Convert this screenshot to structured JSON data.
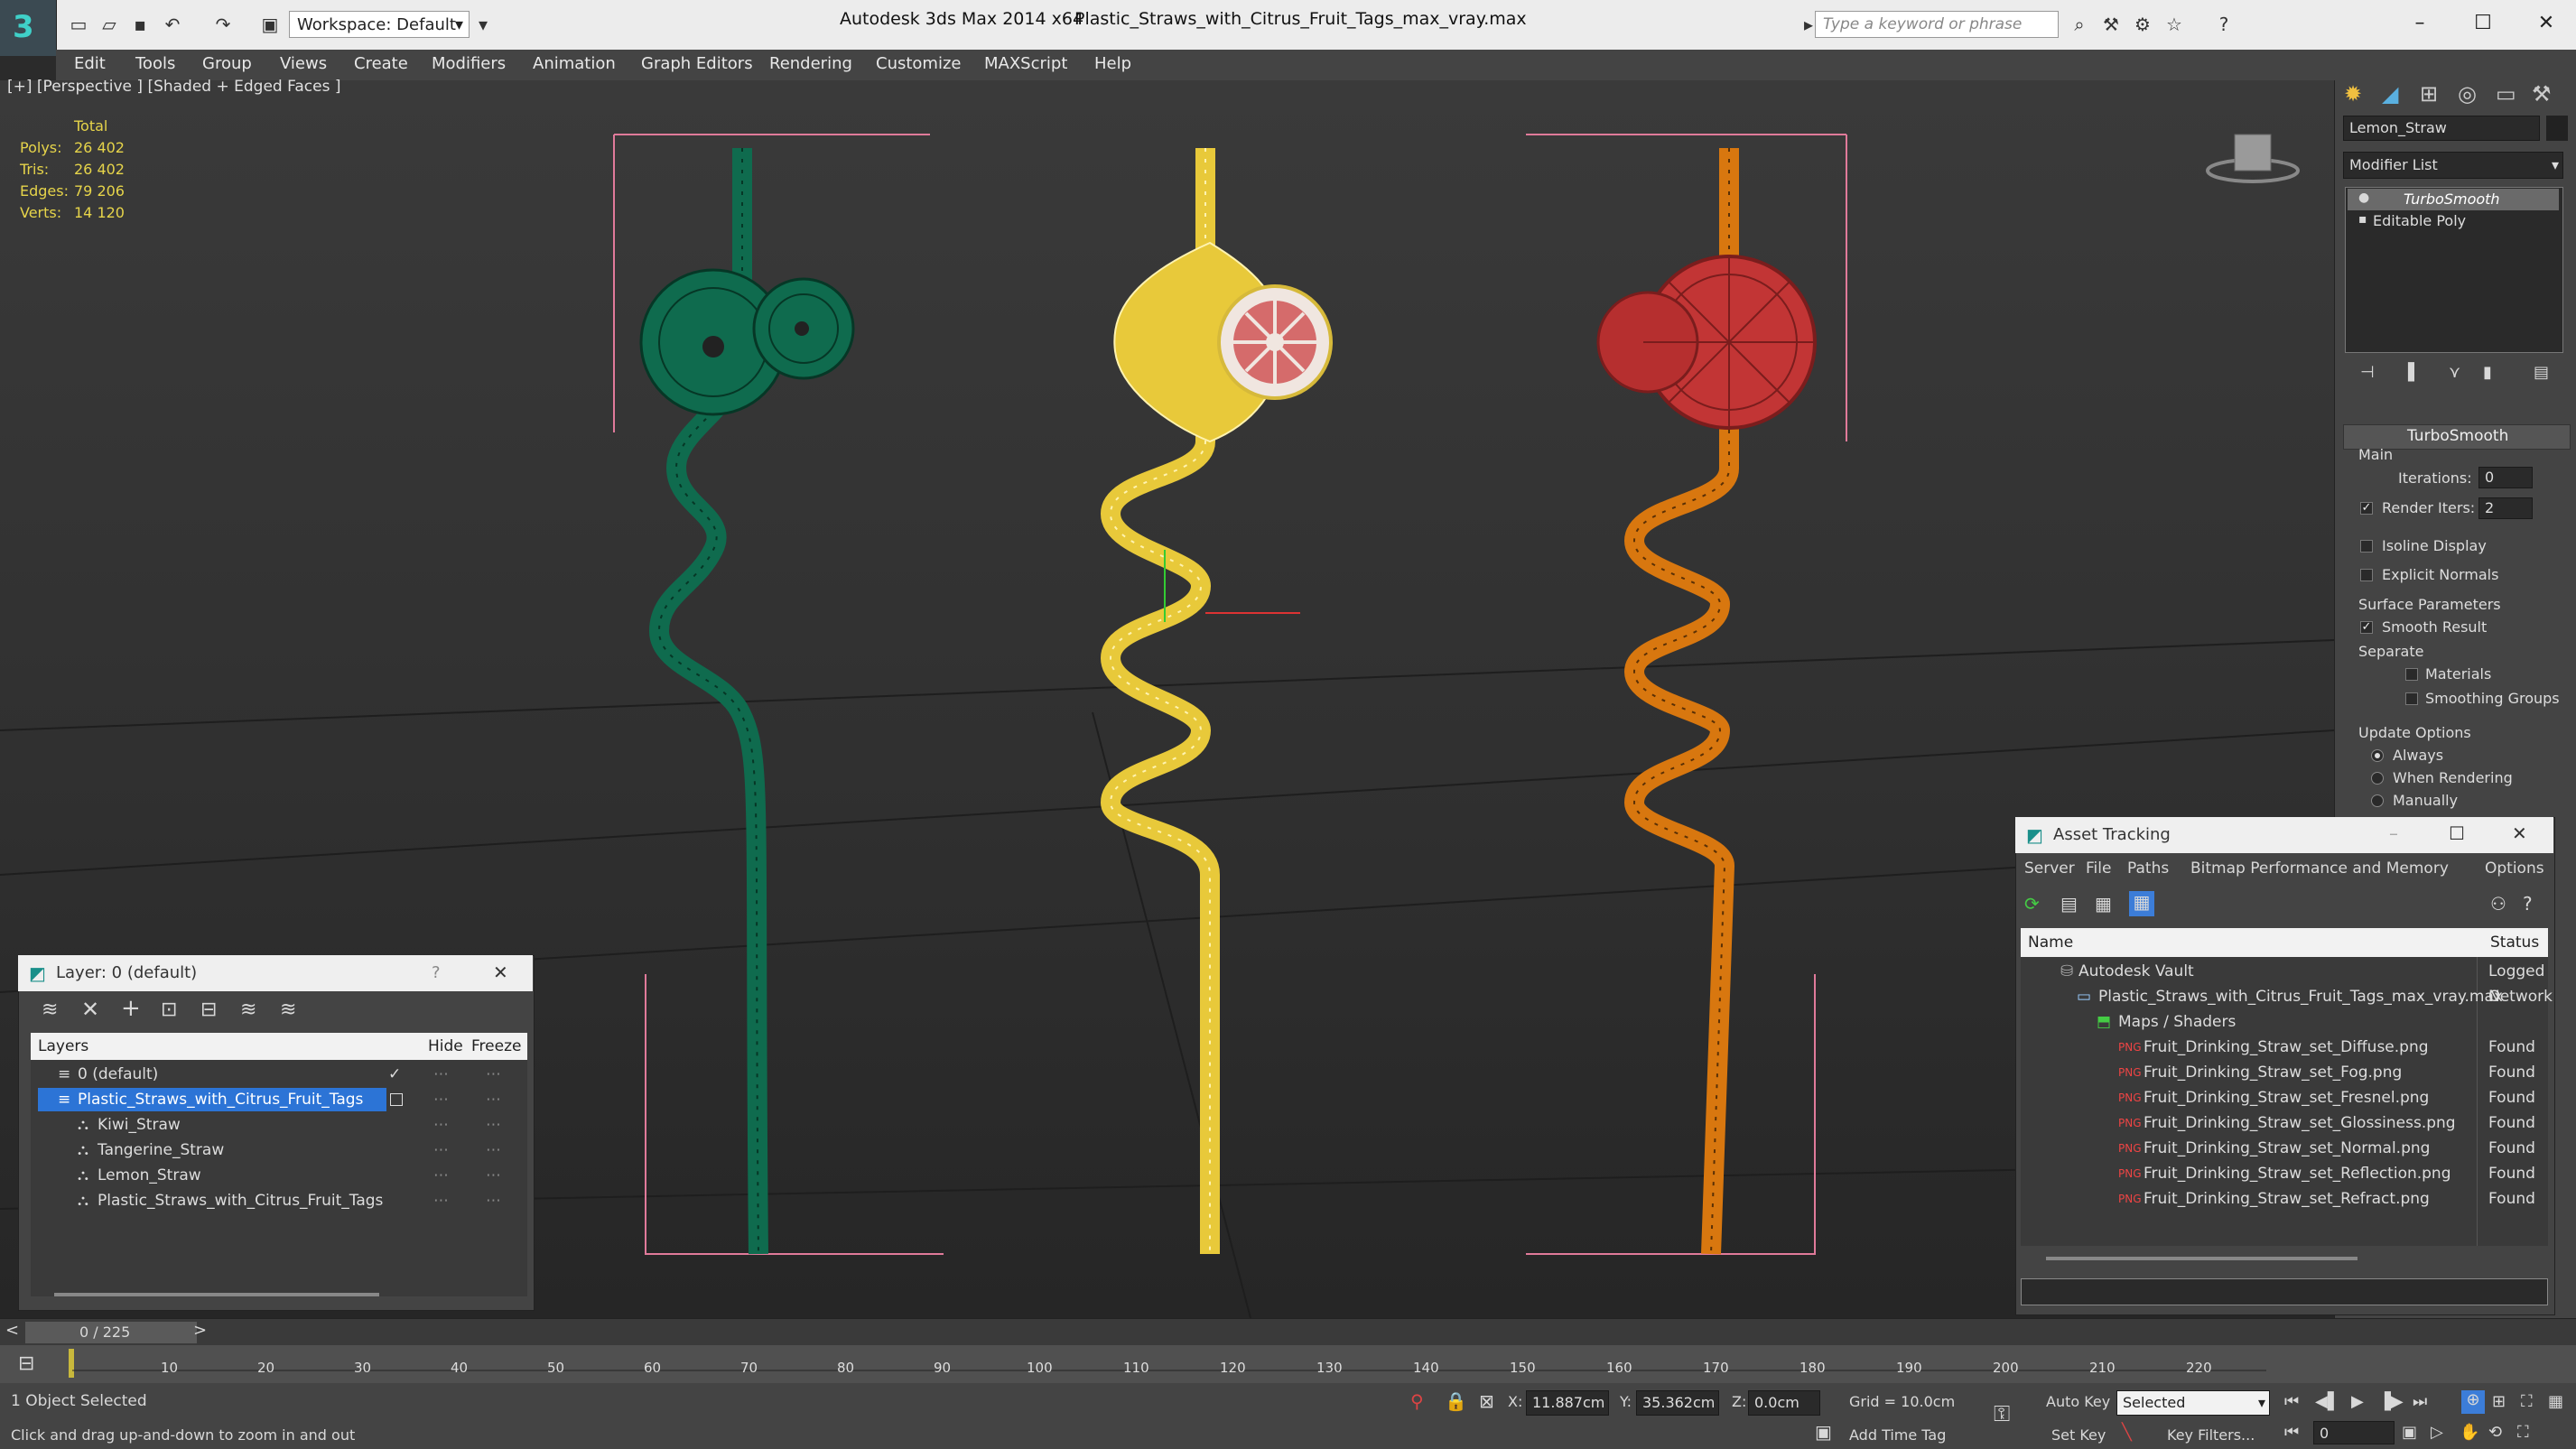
{
  "titlebar": {
    "app_title": "Autodesk 3ds Max  2014 x64",
    "file_title": "Plastic_Straws_with_Citrus_Fruit_Tags_max_vray.max",
    "workspace": "Workspace: Default",
    "search_placeholder": "Type a keyword or phrase"
  },
  "menu": [
    "Edit",
    "Tools",
    "Group",
    "Views",
    "Create",
    "Modifiers",
    "Animation",
    "Graph Editors",
    "Rendering",
    "Customize",
    "MAXScript",
    "Help"
  ],
  "viewport": {
    "label": "[+] [Perspective ] [Shaded + Edged Faces ]",
    "stats": {
      "total_label": "Total",
      "rows": [
        {
          "label": "Polys:",
          "value": "26 402"
        },
        {
          "label": "Tris:",
          "value": "26 402"
        },
        {
          "label": "Edges:",
          "value": "79 206"
        },
        {
          "label": "Verts:",
          "value": "14 120"
        }
      ]
    },
    "straw_colors": {
      "kiwi": "#0f6b4e",
      "lemon": "#e8c93a",
      "tangerine": "#d8770f"
    }
  },
  "command_panel": {
    "object_name": "Lemon_Straw",
    "modifier_list": "Modifier List",
    "stack": [
      "TurboSmooth",
      "Editable Poly"
    ],
    "rollout_title": "TurboSmooth",
    "main_label": "Main",
    "iterations_label": "Iterations:",
    "iterations_value": "0",
    "render_iters_label": "Render Iters:",
    "render_iters_value": "2",
    "isoline_label": "Isoline Display",
    "explicit_normals_label": "Explicit Normals",
    "surface_params_label": "Surface Parameters",
    "smooth_result_label": "Smooth Result",
    "separate_label": "Separate",
    "materials_label": "Materials",
    "smoothing_groups_label": "Smoothing Groups",
    "update_options_label": "Update Options",
    "always_label": "Always",
    "when_rendering_label": "When Rendering",
    "manually_label": "Manually"
  },
  "layer_window": {
    "title": "Layer: 0 (default)",
    "help": "?",
    "col_layers": "Layers",
    "col_hide": "Hide",
    "col_freeze": "Freeze",
    "rows": [
      "0 (default)",
      "Plastic_Straws_with_Citrus_Fruit_Tags",
      "Kiwi_Straw",
      "Tangerine_Straw",
      "Lemon_Straw",
      "Plastic_Straws_with_Citrus_Fruit_Tags"
    ]
  },
  "asset_tracking": {
    "title": "Asset Tracking",
    "menu": [
      "Server",
      "File",
      "Paths",
      "Bitmap Performance and Memory",
      "Options"
    ],
    "col_name": "Name",
    "col_status": "Status",
    "rows": [
      {
        "name": "Autodesk Vault",
        "status": "Logged O"
      },
      {
        "name": "Plastic_Straws_with_Citrus_Fruit_Tags_max_vray.max",
        "status": "Network"
      },
      {
        "name": "Maps / Shaders",
        "status": ""
      },
      {
        "name": "Fruit_Drinking_Straw_set_Diffuse.png",
        "status": "Found"
      },
      {
        "name": "Fruit_Drinking_Straw_set_Fog.png",
        "status": "Found"
      },
      {
        "name": "Fruit_Drinking_Straw_set_Fresnel.png",
        "status": "Found"
      },
      {
        "name": "Fruit_Drinking_Straw_set_Glossiness.png",
        "status": "Found"
      },
      {
        "name": "Fruit_Drinking_Straw_set_Normal.png",
        "status": "Found"
      },
      {
        "name": "Fruit_Drinking_Straw_set_Reflection.png",
        "status": "Found"
      },
      {
        "name": "Fruit_Drinking_Straw_set_Refract.png",
        "status": "Found"
      }
    ]
  },
  "timeline": {
    "frame_counter": "0 / 225",
    "ticks": [
      "10",
      "20",
      "30",
      "40",
      "50",
      "60",
      "70",
      "80",
      "90",
      "100",
      "110",
      "120",
      "130",
      "140",
      "150",
      "160",
      "170",
      "180",
      "190",
      "200",
      "210",
      "220"
    ]
  },
  "status": {
    "selected": "1 Object Selected",
    "hint": "Click and drag up-and-down to zoom in and out",
    "x_label": "X:",
    "x_value": "11.887cm",
    "y_label": "Y:",
    "y_value": "35.362cm",
    "z_label": "Z:",
    "z_value": "0.0cm",
    "grid": "Grid = 10.0cm",
    "auto_key": "Auto Key",
    "selected_dropdown": "Selected",
    "set_key": "Set Key",
    "key_filters": "Key Filters...",
    "add_time_tag": "Add Time Tag",
    "frame_value": "0"
  }
}
